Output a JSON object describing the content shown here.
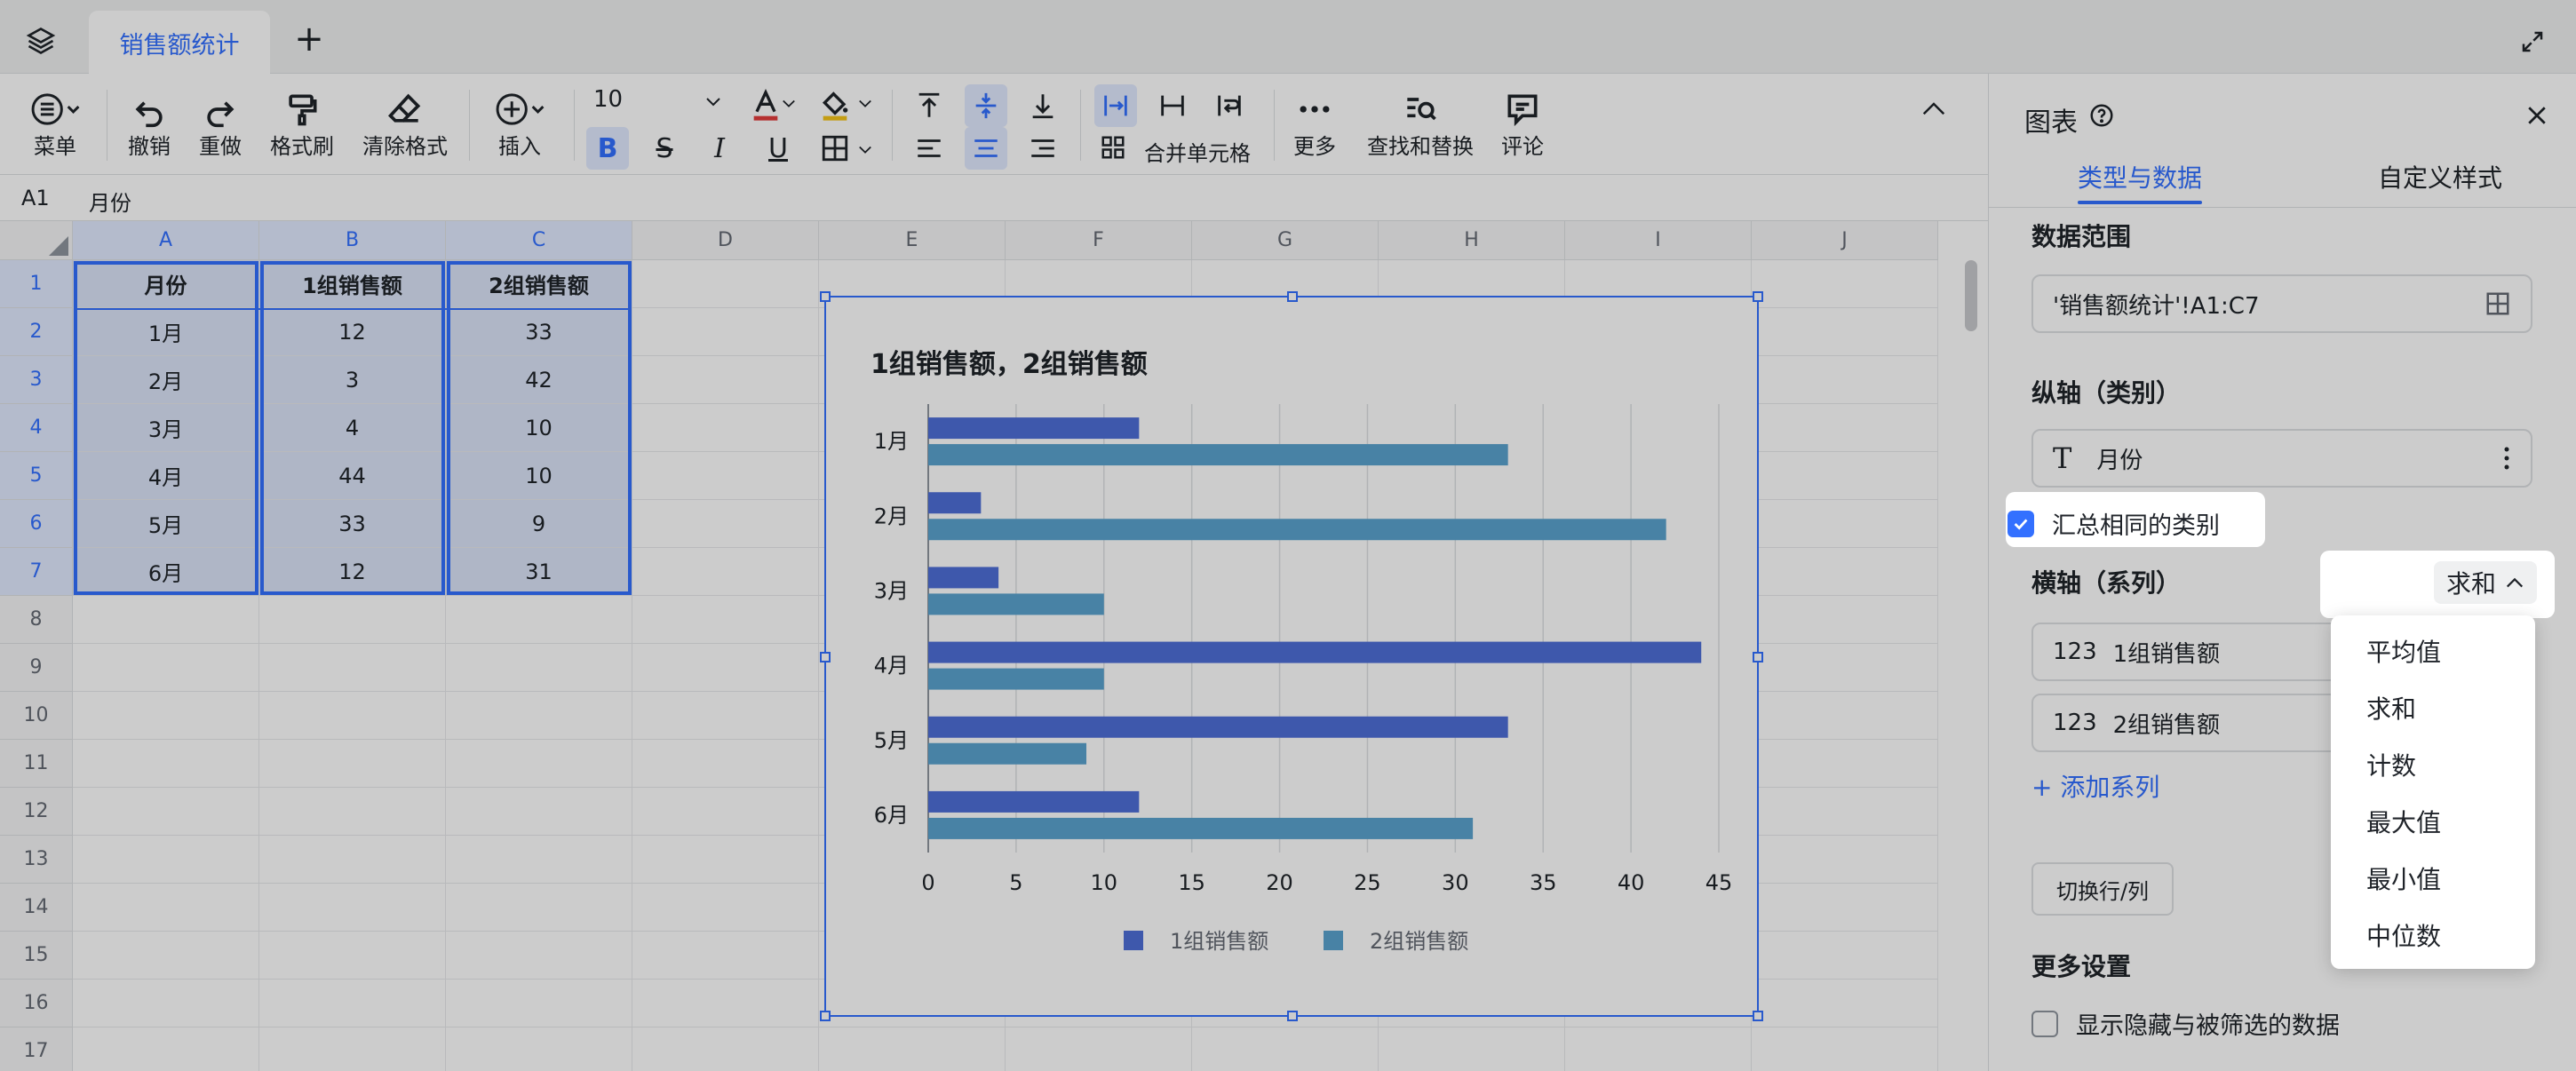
{
  "tab": {
    "title": "销售额统计",
    "add": "+"
  },
  "toolbar": {
    "menu": "菜单",
    "undo": "撤销",
    "redo": "重做",
    "format_painter": "格式刷",
    "clear_format": "清除格式",
    "insert": "插入",
    "font_size": "10",
    "merge_cells": "合并单元格",
    "more": "更多",
    "find_replace": "查找和替换",
    "comment": "评论"
  },
  "formula_bar": {
    "cell_ref": "A1",
    "value": "月份"
  },
  "columns": [
    "A",
    "B",
    "C",
    "D",
    "E",
    "F",
    "G",
    "H",
    "I",
    "J"
  ],
  "rows": [
    "1",
    "2",
    "3",
    "4",
    "5",
    "6",
    "7",
    "8",
    "9",
    "10",
    "11",
    "12",
    "13",
    "14",
    "15",
    "16",
    "17"
  ],
  "table": {
    "headers": [
      "月份",
      "1组销售额",
      "2组销售额"
    ],
    "data": [
      [
        "1月",
        "12",
        "33"
      ],
      [
        "2月",
        "3",
        "42"
      ],
      [
        "3月",
        "4",
        "10"
      ],
      [
        "4月",
        "44",
        "10"
      ],
      [
        "5月",
        "33",
        "9"
      ],
      [
        "6月",
        "12",
        "31"
      ]
    ]
  },
  "chart_data": {
    "type": "bar",
    "orientation": "horizontal",
    "title": "1组销售额，2组销售额",
    "categories": [
      "1月",
      "2月",
      "3月",
      "4月",
      "5月",
      "6月"
    ],
    "series": [
      {
        "name": "1组销售额",
        "values": [
          12,
          3,
          4,
          44,
          33,
          12
        ],
        "color": "#4e6fd8"
      },
      {
        "name": "2组销售额",
        "values": [
          33,
          42,
          10,
          10,
          9,
          31
        ],
        "color": "#5ba3cf"
      }
    ],
    "xticks": [
      "0",
      "5",
      "10",
      "15",
      "20",
      "25",
      "30",
      "35",
      "40",
      "45"
    ],
    "xlim": [
      0,
      45
    ],
    "grid": true,
    "legend": "bottom"
  },
  "panel": {
    "title": "图表",
    "tabs": [
      "类型与数据",
      "自定义样式"
    ],
    "data_range_label": "数据范围",
    "data_range_value": "'销售额统计'!A1:C7",
    "vertical_axis_label": "纵轴（类别）",
    "vertical_axis_field": "月份",
    "aggregate_label": "汇总相同的类别",
    "horizontal_axis_label": "横轴（系列）",
    "aggregate_selected": "求和",
    "series_fields": [
      "1组销售额",
      "2组销售额"
    ],
    "series_type_icon": "123",
    "add_series": "添加系列",
    "switch_rows_cols": "切换行/列",
    "more_settings": "更多设置",
    "show_hidden": "显示隐藏与被筛选的数据"
  },
  "dropdown": {
    "options": [
      "平均值",
      "求和",
      "计数",
      "最大值",
      "最小值",
      "中位数"
    ]
  }
}
